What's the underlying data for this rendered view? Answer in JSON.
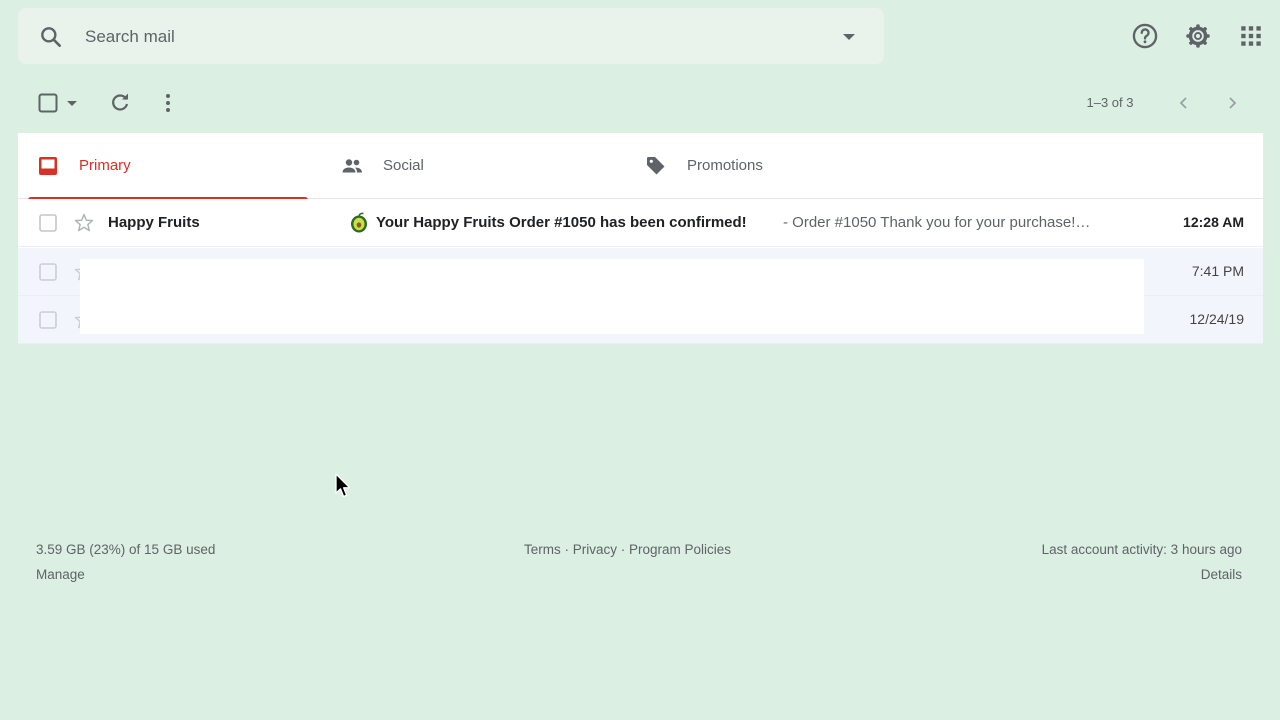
{
  "search": {
    "placeholder": "Search mail"
  },
  "toolbar": {
    "page_range": "1–3 of 3"
  },
  "tabs": [
    {
      "label": "Primary",
      "icon": "inbox-icon",
      "active": true
    },
    {
      "label": "Social",
      "icon": "people-icon"
    },
    {
      "label": "Promotions",
      "icon": "tag-icon"
    }
  ],
  "emails": [
    {
      "sender": "Happy Fruits",
      "subject": "Your Happy Fruits Order #1050 has been confirmed!",
      "snippet": " - Order #1050 Thank you for your purchase!…",
      "time": "12:28 AM",
      "unread": true
    },
    {
      "time": "7:41 PM"
    },
    {
      "time": "12/24/19"
    }
  ],
  "footer": {
    "storage": "3.59 GB (23%) of 15 GB used",
    "manage": "Manage",
    "links": "Terms · Privacy · Program Policies",
    "activity": "Last account activity: 3 hours ago",
    "details": "Details"
  },
  "colors": {
    "background": "#dcefe3",
    "accent": "#d93025"
  }
}
